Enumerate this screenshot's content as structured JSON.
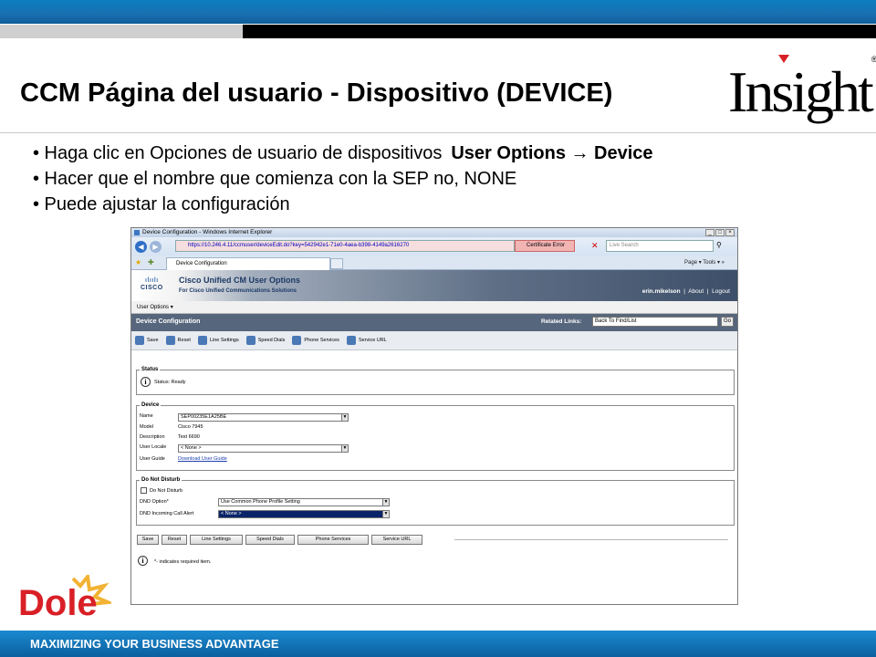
{
  "slide": {
    "title": "CCM Página del usuario - Dispositivo (DEVICE)",
    "bullets": [
      {
        "text": "• Haga clic en Opciones de usuario de dispositivos",
        "bold": "User Options → Device"
      },
      {
        "text": "• Hacer que el nombre que comienza con la SEP no, NONE"
      },
      {
        "text": "• Puede ajustar la configuración"
      }
    ],
    "logo_insight": "Insight",
    "logo_insight_reg": "®",
    "logo_dole": "Dole",
    "tagline": "MAXIMIZING YOUR BUSINESS ADVANTAGE",
    "colors": {
      "band_blue": "#1a6fb0",
      "dole_red": "#d91f26"
    }
  },
  "browser": {
    "window_title": "Device Configuration - Windows Internet Explorer",
    "url": "https://10.246.4.11/ccmuser/deviceEdit.do?key=542942e1-71e0-4aea-b398-4149a2616270",
    "cert_error": "Certificate Error",
    "search_placeholder": "Live Search",
    "tab_label": "Device Configuration",
    "commands": "Page ▾  Tools ▾  »",
    "app_title": "Cisco Unified CM User Options",
    "app_subtitle": "For Cisco Unified Communications Solutions",
    "cisco_word": "CISCO",
    "user": "erin.mikelson",
    "about": "About",
    "logout": "Logout",
    "menu": "User Options",
    "page_title": "Device Configuration",
    "related_label": "Related Links:",
    "related_value": "Back To Find/List",
    "go": "Go",
    "toolbar": [
      "Save",
      "Reset",
      "Line Settings",
      "Speed Dials",
      "Phone Services",
      "Service URL"
    ],
    "status": {
      "legend": "Status",
      "text": "Status: Ready"
    },
    "device": {
      "legend": "Device",
      "name_label": "Name",
      "name_value": "SEP00235E1A25BE",
      "model_label": "Model",
      "model_value": "Cisco 7945",
      "desc_label": "Description",
      "desc_value": "Test 6690",
      "locale_label": "User Locale",
      "locale_value": "< None >",
      "guide_label": "User Guide",
      "guide_link": "Download User Guide"
    },
    "dnd": {
      "legend": "Do Not Disturb",
      "checkbox_label": "Do Not Disturb",
      "option_label": "DND Option*",
      "option_value": "Use Common Phone Profile Setting",
      "alert_label": "DND Incoming Call Alert",
      "alert_value": "< None >"
    },
    "buttons": [
      "Save",
      "Reset",
      "Line Settings",
      "Speed Dials",
      "Phone Services",
      "Service URL"
    ],
    "required_note": "*- indicates required item."
  }
}
